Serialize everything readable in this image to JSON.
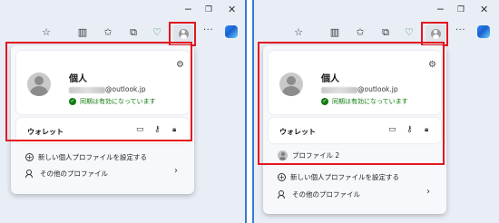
{
  "window_controls": {
    "minimize": "─",
    "restore": "❐",
    "close": "✕"
  },
  "toolbar_icons": [
    "star-icon",
    "split-screen-icon",
    "favorites-icon",
    "collections-icon",
    "browser-essentials-icon",
    "profile-icon",
    "more-icon",
    "copilot-icon"
  ],
  "toolbar_glyphs": {
    "star": "☆",
    "split": "▥",
    "favorites": "✩",
    "collections": "⧉",
    "essentials": "♡",
    "more": "···"
  },
  "left_panel": {
    "profile_name": "個人",
    "email_suffix": "@outlook.jp",
    "sync_status": "同期は有効になっています",
    "wallet_label": "ウォレット",
    "new_profile": "新しい個人プロファイルを設定する",
    "other_profiles": "その他のプロファイル"
  },
  "right_panel": {
    "profile_name": "個人",
    "email_suffix": "@outlook.jp",
    "sync_status": "同期は有効になっています",
    "wallet_label": "ウォレット",
    "profile2_label": "プロファイル 2",
    "new_profile": "新しい個人プロファイルを設定する",
    "other_profiles": "その他のプロファイル"
  },
  "glyphs": {
    "gear": "⚙",
    "card": "▭",
    "key": "⚷",
    "lock": "🔒︎",
    "plus": "+",
    "chevron": "›",
    "check": "✓"
  },
  "colors": {
    "highlight": "#e3161f",
    "sync_green": "#107c10",
    "window_border": "#3a7bd5"
  }
}
